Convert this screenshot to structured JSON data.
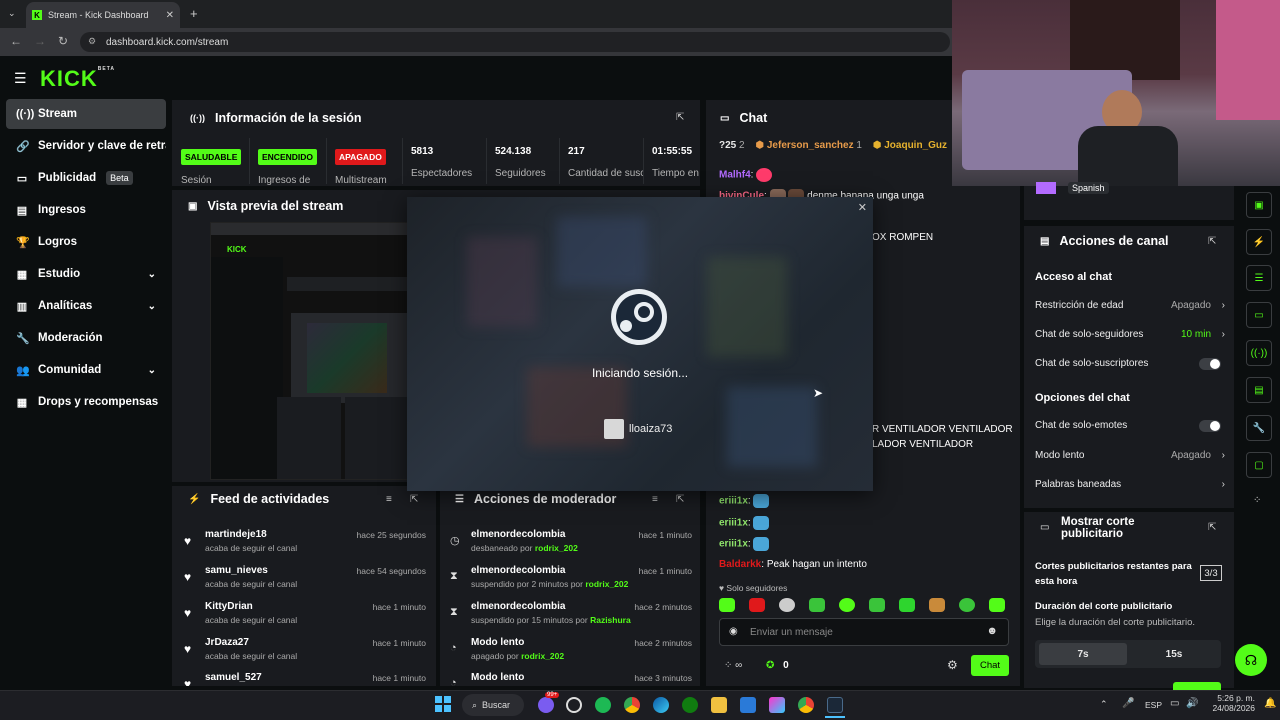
{
  "browser": {
    "tab_title": "Stream - Kick Dashboard",
    "url": "dashboard.kick.com/stream"
  },
  "brand": {
    "logo": "KICK",
    "logo_tag": "BETA",
    "accent": "#53fc18"
  },
  "sidebar": {
    "items": [
      {
        "label": "Stream",
        "icon": "broadcast-icon"
      },
      {
        "label": "Servidor y clave de retransmisión",
        "icon": "key-icon"
      },
      {
        "label": "Publicidad",
        "badge": "Beta",
        "icon": "ad-icon"
      },
      {
        "label": "Ingresos",
        "icon": "revenue-icon"
      },
      {
        "label": "Logros",
        "icon": "trophy-icon"
      },
      {
        "label": "Estudio",
        "icon": "studio-icon"
      },
      {
        "label": "Analíticas",
        "icon": "analytics-icon"
      },
      {
        "label": "Moderación",
        "icon": "wrench-icon"
      },
      {
        "label": "Comunidad",
        "icon": "community-icon"
      },
      {
        "label": "Drops y recompensas",
        "icon": "drops-icon"
      }
    ]
  },
  "session": {
    "title": "Información de la sesión",
    "stats": [
      {
        "badge": "SALUDABLE",
        "label": "Sesión"
      },
      {
        "badge": "ENCENDIDO",
        "label": "Ingresos de"
      },
      {
        "badge": "APAGADO",
        "label": "Multistream"
      },
      {
        "value": "5813",
        "label": "Espectadores"
      },
      {
        "value": "524.138",
        "label": "Seguidores"
      },
      {
        "value": "217",
        "label": "Cantidad de suscripciones"
      },
      {
        "value": "01:55:55",
        "label": "Tiempo en vivo"
      }
    ]
  },
  "preview": {
    "title": "Vista previa del stream"
  },
  "feed": {
    "title": "Feed de actividades",
    "items": [
      {
        "name": "martindeje18",
        "sub": "acaba de seguir el canal",
        "time": "hace 25 segundos"
      },
      {
        "name": "samu_nieves",
        "sub": "acaba de seguir el canal",
        "time": "hace 54 segundos"
      },
      {
        "name": "KittyDrian",
        "sub": "acaba de seguir el canal",
        "time": "hace 1 minuto"
      },
      {
        "name": "JrDaza27",
        "sub": "acaba de seguir el canal",
        "time": "hace 1 minuto"
      },
      {
        "name": "samuel_527",
        "sub": "",
        "time": "hace 1 minuto"
      }
    ]
  },
  "mod": {
    "title": "Acciones de moderador",
    "items": [
      {
        "name": "elmenordecolombia",
        "sub_pre": "desbaneado por ",
        "by": "rodrix_202",
        "time": "hace 1 minuto"
      },
      {
        "name": "elmenordecolombia",
        "sub_pre": "suspendido por 2 minutos por ",
        "by": "rodrix_202",
        "time": "hace 1 minuto"
      },
      {
        "name": "elmenordecolombia",
        "sub_pre": "suspendido por 15 minutos por ",
        "by": "Razishura",
        "time": "hace 2 minutos"
      },
      {
        "name": "Modo lento",
        "sub_pre": "apagado por ",
        "by": "rodrix_202",
        "time": "hace 2 minutos"
      },
      {
        "name": "Modo lento",
        "sub_pre": "",
        "by": "",
        "time": "hace 3 minutos"
      }
    ]
  },
  "chat": {
    "title": "Chat",
    "top_gifters": [
      {
        "rank": "?25",
        "count": "2"
      },
      {
        "name": "Jeferson_sanchez",
        "count": "1"
      },
      {
        "name": "Joaquin_Guz"
      }
    ],
    "lines": [
      {
        "user": "Malhf4",
        "text": ""
      },
      {
        "user": "bivinCule",
        "text": "denme banana unga unga"
      },
      {
        "user": "",
        "text": "OX ROMPEN"
      },
      {
        "user": "",
        "text": "R VENTILADOR VENTILADOR"
      },
      {
        "user": "",
        "text": "LADOR VENTILADOR"
      },
      {
        "user": "eriii1x",
        "text": ""
      },
      {
        "user": "eriii1x",
        "text": ""
      },
      {
        "user": "eriii1x",
        "text": ""
      },
      {
        "user": "Baldarkk",
        "text": "Peak hagan un intento"
      }
    ],
    "followers_only": "Solo seguidores",
    "input_placeholder": "Enviar un mensaje",
    "points": "0",
    "send_label": "Chat"
  },
  "steam_dialog": {
    "status": "Iniciando sesión...",
    "account": "lloaiza73"
  },
  "webcam": {
    "language": "Spanish"
  },
  "channel_actions": {
    "title": "Acciones de canal",
    "chat_access": "Acceso al chat",
    "rows": [
      {
        "label": "Restricción de edad",
        "value": "Apagado"
      },
      {
        "label": "Chat de solo-seguidores",
        "value": "10 min"
      },
      {
        "label": "Chat de solo-suscriptores",
        "value": ""
      }
    ],
    "chat_options": "Opciones del chat",
    "rows2": [
      {
        "label": "Chat de solo-emotes",
        "value": ""
      },
      {
        "label": "Modo lento",
        "value": "Apagado"
      },
      {
        "label": "Palabras baneadas",
        "value": ""
      }
    ]
  },
  "ad_break": {
    "title": "Mostrar corte publicitario",
    "remaining_label": "Cortes publicitarios restantes para esta hora",
    "remaining_value": "3/3",
    "duration_label": "Duración del corte publicitario",
    "duration_hint": "Elige la duración del corte publicitario.",
    "options": [
      "7s",
      "15s"
    ]
  },
  "taskbar": {
    "search": "Buscar",
    "lang": "ESP",
    "time": "5:26 p. m.",
    "date": "24/08/2026",
    "badge": "99+"
  }
}
